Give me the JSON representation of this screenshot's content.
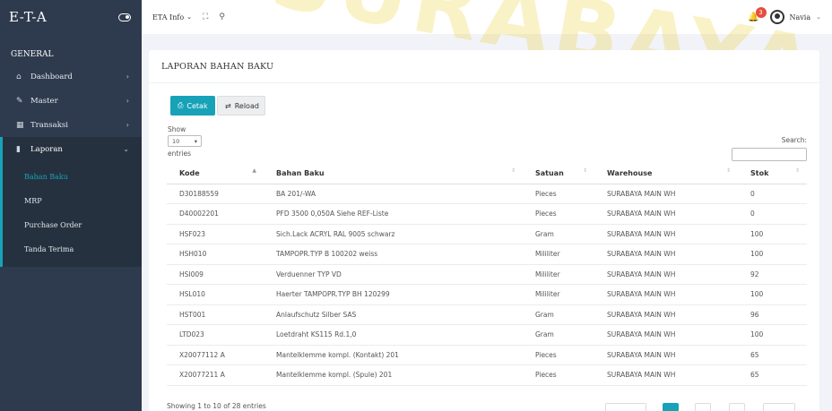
{
  "app": {
    "brand": "E-T-A"
  },
  "topbar": {
    "menu_label": "ETA Info",
    "notification_count": "3",
    "user_name": "Navia"
  },
  "sidebar": {
    "section": "GENERAL",
    "items": [
      {
        "label": "Dashboard",
        "icon": "home-icon"
      },
      {
        "label": "Master",
        "icon": "edit-icon"
      },
      {
        "label": "Transaksi",
        "icon": "grid-icon"
      },
      {
        "label": "Laporan",
        "icon": "bar-chart-icon"
      }
    ],
    "sub_items": [
      {
        "label": "Bahan Baku",
        "active": true
      },
      {
        "label": "MRP"
      },
      {
        "label": "Purchase Order"
      },
      {
        "label": "Tanda Terima"
      }
    ]
  },
  "page": {
    "title": "LAPORAN BAHAN BAKU",
    "buttons": {
      "print": "Cetak",
      "reload": "Reload"
    },
    "length": {
      "show": "Show",
      "value": "10",
      "entries": "entries"
    },
    "search_label": "Search:",
    "info": "Showing 1 to 10 of 28 entries"
  },
  "table": {
    "columns": [
      "Kode",
      "Bahan Baku",
      "Satuan",
      "Warehouse",
      "Stok"
    ],
    "rows": [
      [
        "D30188559",
        "BA 201/-WA",
        "Pieces",
        "SURABAYA MAIN WH",
        "0"
      ],
      [
        "D40002201",
        "PFD 3500 0,050A Siehe REF-Liste",
        "Pieces",
        "SURABAYA MAIN WH",
        "0"
      ],
      [
        "HSF023",
        "Sich.Lack ACRYL RAL 9005 schwarz",
        "Gram",
        "SURABAYA MAIN WH",
        "100"
      ],
      [
        "HSH010",
        "TAMPOPR.TYP B 100202 weiss",
        "Mililiter",
        "SURABAYA MAIN WH",
        "100"
      ],
      [
        "HSI009",
        "Verduenner TYP VD",
        "Mililiter",
        "SURABAYA MAIN WH",
        "92"
      ],
      [
        "HSL010",
        "Haerter TAMPOPR.TYP BH 120299",
        "Mililiter",
        "SURABAYA MAIN WH",
        "100"
      ],
      [
        "HST001",
        "Anlaufschutz Silber SAS",
        "Gram",
        "SURABAYA MAIN WH",
        "96"
      ],
      [
        "LTD023",
        "Loetdraht KS115 Rd.1,0",
        "Gram",
        "SURABAYA MAIN WH",
        "100"
      ],
      [
        "X20077112 A",
        "Mantelklemme kompl. (Kontakt) 201",
        "Pieces",
        "SURABAYA MAIN WH",
        "65"
      ],
      [
        "X20077211 A",
        "Mantelklemme kompl. (Spule) 201",
        "Pieces",
        "SURABAYA MAIN WH",
        "65"
      ]
    ]
  },
  "watermark": "SURABAYA",
  "colors": {
    "sidebar": "#2e3b4e",
    "accent": "#17a2b8",
    "badge": "#e74c3c",
    "watermark": "#e8c400"
  }
}
